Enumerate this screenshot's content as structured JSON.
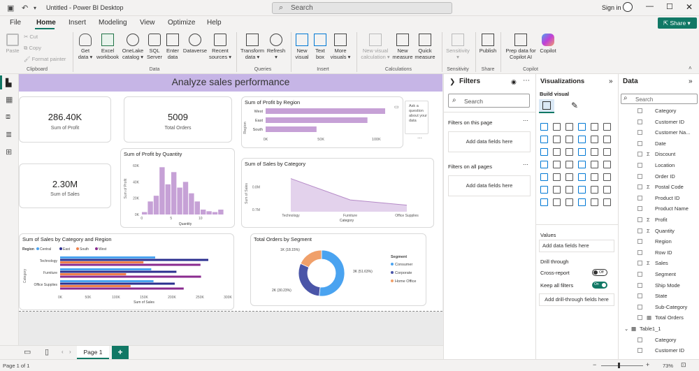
{
  "titlebar": {
    "title": "Untitled - Power BI Desktop",
    "search_placeholder": "Search",
    "signin": "Sign in",
    "share": "Share"
  },
  "menu": [
    "File",
    "Home",
    "Insert",
    "Modeling",
    "View",
    "Optimize",
    "Help"
  ],
  "ribbon": {
    "clipboard": {
      "paste": "Paste",
      "cut": "Cut",
      "copy": "Copy",
      "format_painter": "Format painter",
      "group": "Clipboard"
    },
    "data": {
      "get_data": "Get data",
      "excel": "Excel workbook",
      "onelake": "OneLake catalog",
      "sql": "SQL Server",
      "enter": "Enter data",
      "dataverse": "Dataverse",
      "recent": "Recent sources",
      "group": "Data"
    },
    "queries": {
      "transform": "Transform data",
      "refresh": "Refresh",
      "group": "Queries"
    },
    "insert": {
      "new_visual": "New visual",
      "text_box": "Text box",
      "more_visuals": "More visuals",
      "group": "Insert"
    },
    "calculations": {
      "new_visual_calc": "New visual calculation",
      "new_measure": "New measure",
      "quick_measure": "Quick measure",
      "group": "Calculations"
    },
    "sensitivity": {
      "label": "Sensitivity",
      "group": "Sensitivity"
    },
    "share": {
      "publish": "Publish",
      "group": "Share"
    },
    "copilot": {
      "prep": "Prep data for Copilot AI",
      "copilot": "Copilot",
      "group": "Copilot"
    }
  },
  "report": {
    "banner": "Analyze sales performance",
    "card_profit": {
      "value": "286.40K",
      "label": "Sum of Profit"
    },
    "card_orders": {
      "value": "5009",
      "label": "Total Orders"
    },
    "card_sales": {
      "value": "2.30M",
      "label": "Sum of Sales"
    },
    "qa": "Ask a question about your data"
  },
  "chart_data": [
    {
      "type": "bar",
      "title": "Sum of Profit by Region",
      "categories": [
        "West",
        "East",
        "South"
      ],
      "values": [
        108000,
        92000,
        46000
      ],
      "xticks": [
        "0K",
        "50K",
        "100K"
      ],
      "ylabel": "Region"
    },
    {
      "type": "bar",
      "title": "Sum of Profit by Quantity",
      "x": [
        1,
        2,
        3,
        4,
        5,
        6,
        7,
        8,
        9,
        10,
        11,
        12,
        13,
        14
      ],
      "values": [
        3000,
        16000,
        23000,
        58000,
        37000,
        52000,
        33000,
        40000,
        26000,
        16000,
        6000,
        4000,
        3000,
        6000
      ],
      "yticks": [
        "0K",
        "20K",
        "40K",
        "60K"
      ],
      "xticks": [
        "0",
        "5",
        "10"
      ],
      "xlabel": "Quantity",
      "ylabel": "Sum of Profit"
    },
    {
      "type": "area",
      "title": "Sum of Sales by Category",
      "categories": [
        "Technology",
        "Furniture",
        "Office Supplies"
      ],
      "values": [
        836000,
        742000,
        719000
      ],
      "yticks": [
        "0.7M",
        "0.8M"
      ],
      "xlabel": "Category",
      "ylabel": "Sum of Sales"
    },
    {
      "type": "bar",
      "title": "Sum of Sales by Category and Region",
      "categories": [
        "Technology",
        "Furniture",
        "Office Supplies"
      ],
      "legend_title": "Region",
      "series": [
        {
          "name": "Central",
          "values": [
            170000,
            163000,
            167000
          ]
        },
        {
          "name": "East",
          "values": [
            265000,
            208000,
            205000
          ]
        },
        {
          "name": "South",
          "values": [
            149000,
            118000,
            126000
          ]
        },
        {
          "name": "West",
          "values": [
            251000,
            252000,
            221000
          ]
        }
      ],
      "xticks": [
        "0K",
        "50K",
        "100K",
        "150K",
        "200K",
        "250K",
        "300K"
      ],
      "xlabel": "Sum of Sales",
      "ylabel": "Category"
    },
    {
      "type": "pie",
      "title": "Total Orders by Segment",
      "legend_title": "Segment",
      "categories": [
        "Consumer",
        "Corporate",
        "Home Office"
      ],
      "values": [
        2586,
        1514,
        909
      ],
      "labels": [
        "3K (51.63%)",
        "2K (30.23%)",
        "1K (18.15%)"
      ]
    }
  ],
  "colors": {
    "central": "#4aa3f0",
    "east": "#2b2f8f",
    "south": "#f0814a",
    "west": "#8a2b8f",
    "consumer": "#4aa3f0",
    "corporate": "#4a55a8",
    "home_office": "#f0a06a",
    "bar": "#c6a1d6"
  },
  "filters": {
    "title": "Filters",
    "search": "Search",
    "on_page": "Filters on this page",
    "on_all": "Filters on all pages",
    "add": "Add data fields here"
  },
  "viz": {
    "title": "Visualizations",
    "build": "Build visual",
    "values": "Values",
    "add_values": "Add data fields here",
    "drill": "Drill through",
    "cross": "Cross-report",
    "cross_state": "Off",
    "keep": "Keep all filters",
    "keep_state": "On",
    "add_drill": "Add drill-through fields here"
  },
  "data": {
    "title": "Data",
    "search": "Search",
    "fields": [
      {
        "n": "Category",
        "t": ""
      },
      {
        "n": "Customer ID",
        "t": ""
      },
      {
        "n": "Customer Na...",
        "t": ""
      },
      {
        "n": "Date",
        "t": ""
      },
      {
        "n": "Discount",
        "t": "Σ"
      },
      {
        "n": "Location",
        "t": ""
      },
      {
        "n": "Order ID",
        "t": ""
      },
      {
        "n": "Postal Code",
        "t": "Σ"
      },
      {
        "n": "Product ID",
        "t": ""
      },
      {
        "n": "Product Name",
        "t": ""
      },
      {
        "n": "Profit",
        "t": "Σ"
      },
      {
        "n": "Quantity",
        "t": "Σ"
      },
      {
        "n": "Region",
        "t": ""
      },
      {
        "n": "Row ID",
        "t": ""
      },
      {
        "n": "Sales",
        "t": "Σ"
      },
      {
        "n": "Segment",
        "t": ""
      },
      {
        "n": "Ship Mode",
        "t": ""
      },
      {
        "n": "State",
        "t": ""
      },
      {
        "n": "Sub-Category",
        "t": ""
      },
      {
        "n": "Total Orders",
        "t": "▦"
      }
    ],
    "table2": "Table1_1",
    "table2_fields": [
      "Category",
      "Customer ID"
    ]
  },
  "tabs": {
    "page1": "Page 1",
    "add": "+"
  },
  "status": {
    "page": "Page 1 of 1",
    "zoom": "73%"
  }
}
